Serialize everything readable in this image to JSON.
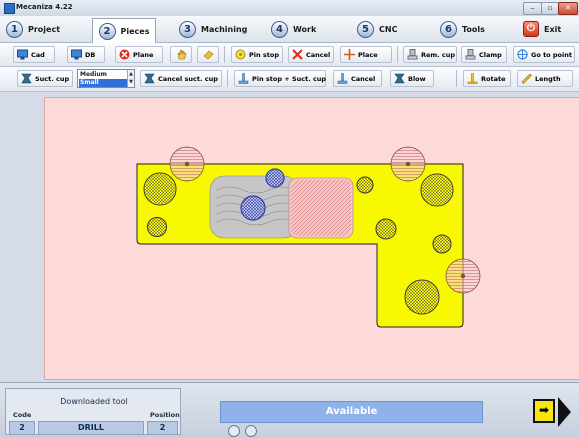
{
  "window": {
    "title": "Mecaniza 4.22"
  },
  "tabs": [
    {
      "num": "1",
      "label": "Project"
    },
    {
      "num": "2",
      "label": "Pieces"
    },
    {
      "num": "3",
      "label": "Machining"
    },
    {
      "num": "4",
      "label": "Work"
    },
    {
      "num": "5",
      "label": "CNC"
    },
    {
      "num": "6",
      "label": "Tools"
    }
  ],
  "exit": {
    "label": "Exit"
  },
  "toolbar1": {
    "cad": "Cad",
    "db": "DB",
    "plane": "Plane",
    "pin_stop": "Pin stop",
    "cancel": "Cancel",
    "place": "Place",
    "rem_cup": "Rem. cup",
    "clamp": "Clamp",
    "go_to_point": "Go to point"
  },
  "toolbar2": {
    "suct_cup": "Suct. cup",
    "size_options": [
      "Medium",
      "Small"
    ],
    "cancel_suct_cup": "Cancel suct. cup",
    "pin_stop_suct_cup": "Pin stop + Suct. cup",
    "cancel": "Cancel",
    "blow": "Blow",
    "rotate": "Rotate",
    "length": "Length"
  },
  "status": {
    "header": "Downloaded tool",
    "code_label": "Code",
    "position_label": "Position",
    "code": "2",
    "tool": "DRILL",
    "position": "2",
    "availability": "Available"
  },
  "colors": {
    "piece": "#f8f800",
    "background": "#fdd9d9",
    "suction_cup": "#2d3fa6",
    "status_bar": "#8fb2ea"
  }
}
